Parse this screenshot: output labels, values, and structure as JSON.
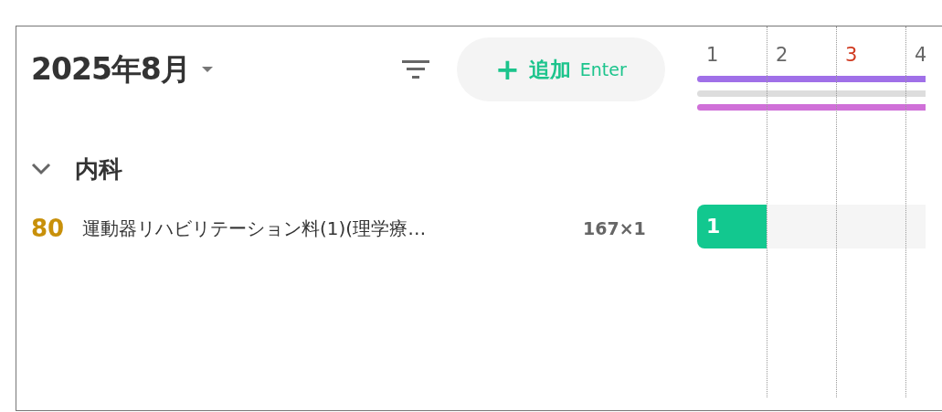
{
  "header": {
    "title": "2025年8月",
    "add_button": {
      "plus": "+",
      "label": "追加",
      "shortcut": "Enter"
    }
  },
  "timeline": {
    "days": [
      {
        "label": "1",
        "holiday": false
      },
      {
        "label": "2",
        "holiday": false
      },
      {
        "label": "3",
        "holiday": true
      },
      {
        "label": "4",
        "holiday": false
      }
    ],
    "bars": [
      {
        "color": "#a070e8"
      },
      {
        "color": "#dddddd"
      },
      {
        "color": "#d070d8"
      }
    ]
  },
  "groups": [
    {
      "name": "内科",
      "expanded": true,
      "items": [
        {
          "points": "80",
          "name": "運動器リハビリテーション料(1)(理学療…",
          "count": "167×1",
          "cells": [
            {
              "text": "1",
              "filled": true
            },
            {
              "filled": false
            },
            {
              "filled": false
            },
            {
              "filled": false
            }
          ]
        }
      ]
    }
  ]
}
